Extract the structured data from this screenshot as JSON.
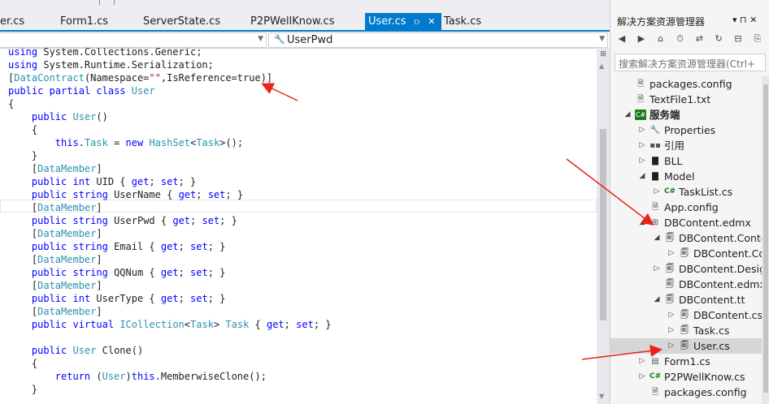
{
  "editor": {
    "tabs": [
      {
        "label": "er.cs"
      },
      {
        "label": "Form1.cs"
      },
      {
        "label": "ServerState.cs"
      },
      {
        "label": "P2PWellKnow.cs"
      },
      {
        "label": "User.cs",
        "active": true
      },
      {
        "label": "Task.cs"
      }
    ],
    "active_tab_pin": "⫐",
    "active_tab_close": "✕",
    "member_dropdown_value": "UserPwd",
    "code_lines": [
      "using System.Collections.Generic;",
      "using System.Runtime.Serialization;",
      "[DataContract(Namespace=\"\",IsReference=true)]",
      "public partial class User",
      "{",
      "    public User()",
      "    {",
      "        this.Task = new HashSet<Task>();",
      "    }",
      "    [DataMember]",
      "    public int UID { get; set; }",
      "    public string UserName { get; set; }",
      "    [DataMember]",
      "    public string UserPwd { get; set; }",
      "    [DataMember]",
      "    public string Email { get; set; }",
      "    [DataMember]",
      "    public string QQNum { get; set; }",
      "    [DataMember]",
      "    public int UserType { get; set; }",
      "    [DataMember]",
      "    public virtual ICollection<Task> Task { get; set; }",
      "",
      "    public User Clone()",
      "    {",
      "        return (User)this.MemberwiseClone();",
      "    }"
    ]
  },
  "solution_explorer": {
    "title": "解决方案资源管理器",
    "title_tools": "▾ ⊓ ✕",
    "search_placeholder": "搜索解决方案资源管理器(Ctrl+",
    "tree": [
      {
        "label": "packages.config",
        "icon": "config-icon",
        "indent": 0,
        "expander": ""
      },
      {
        "label": "TextFile1.txt",
        "icon": "text-file-icon",
        "indent": 0,
        "expander": ""
      },
      {
        "label": "服务端",
        "icon": "csharp-project-icon",
        "indent": 0,
        "expander": "open",
        "bold": true
      },
      {
        "label": "Properties",
        "icon": "wrench-icon",
        "indent": 1,
        "expander": "closed"
      },
      {
        "label": "引用",
        "icon": "references-icon",
        "indent": 1,
        "expander": "closed"
      },
      {
        "label": "BLL",
        "icon": "folder-icon",
        "indent": 1,
        "expander": "closed"
      },
      {
        "label": "Model",
        "icon": "folder-icon",
        "indent": 1,
        "expander": "open"
      },
      {
        "label": "TaskList.cs",
        "icon": "csharp-file-icon",
        "indent": 2,
        "expander": "closed"
      },
      {
        "label": "App.config",
        "icon": "config-icon",
        "indent": 1,
        "expander": ""
      },
      {
        "label": "DBContent.edmx",
        "icon": "edmx-icon",
        "indent": 1,
        "expander": "open"
      },
      {
        "label": "DBContent.Conte",
        "icon": "tt-file-icon",
        "indent": 2,
        "expander": "open"
      },
      {
        "label": "DBContent.Co",
        "icon": "tt-file-icon",
        "indent": 3,
        "expander": "closed"
      },
      {
        "label": "DBContent.Desig",
        "icon": "tt-file-icon",
        "indent": 2,
        "expander": "closed"
      },
      {
        "label": "DBContent.edmx",
        "icon": "tt-file-icon",
        "indent": 2,
        "expander": ""
      },
      {
        "label": "DBContent.tt",
        "icon": "tt-file-icon",
        "indent": 2,
        "expander": "open"
      },
      {
        "label": "DBContent.cs",
        "icon": "tt-file-icon",
        "indent": 3,
        "expander": "closed"
      },
      {
        "label": "Task.cs",
        "icon": "tt-file-icon",
        "indent": 3,
        "expander": "closed"
      },
      {
        "label": "User.cs",
        "icon": "tt-file-icon",
        "indent": 3,
        "expander": "closed",
        "selected": true
      },
      {
        "label": "Form1.cs",
        "icon": "form-icon",
        "indent": 1,
        "expander": "closed"
      },
      {
        "label": "P2PWellKnow.cs",
        "icon": "csharp-file-icon",
        "indent": 1,
        "expander": "closed"
      },
      {
        "label": "packages.config",
        "icon": "config-icon",
        "indent": 1,
        "expander": ""
      }
    ]
  },
  "colors": {
    "accent": "#007acc",
    "keyword": "#0000ff",
    "type": "#2b91af",
    "string": "#a31515",
    "annotation_arrow": "#e8231c"
  }
}
